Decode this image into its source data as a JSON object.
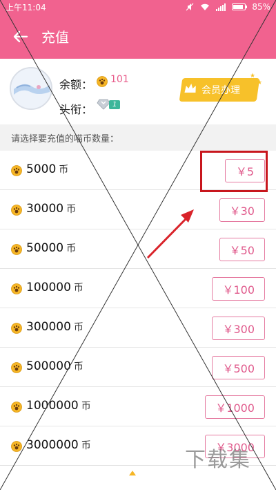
{
  "status": {
    "time": "上午11:04",
    "battery": "85%"
  },
  "appbar": {
    "title": "充值"
  },
  "profile": {
    "balance_label": "余额：",
    "balance_value": "101",
    "title_label": "头衔：",
    "rank_badge": "1",
    "vip_button": "会员办理"
  },
  "section_hint": "请选择要充值的喵币数量：",
  "unit": "币",
  "packages": [
    {
      "amount": "5000",
      "price": "￥5"
    },
    {
      "amount": "30000",
      "price": "￥30"
    },
    {
      "amount": "50000",
      "price": "￥50"
    },
    {
      "amount": "100000",
      "price": "￥100"
    },
    {
      "amount": "300000",
      "price": "￥300"
    },
    {
      "amount": "500000",
      "price": "￥500"
    },
    {
      "amount": "1000000",
      "price": "￥1000"
    },
    {
      "amount": "3000000",
      "price": "￥3000"
    }
  ],
  "watermark": "下载集",
  "colors": {
    "primary": "#f1628f",
    "price_text": "#e05a8c",
    "highlight": "#c8161d",
    "arrow": "#d9232a",
    "vip": "#f7c12a"
  },
  "icons": {
    "back": "arrow-left-icon",
    "coin": "paw-coin-icon",
    "crown": "crown-icon",
    "rank": "diamond-icon"
  }
}
